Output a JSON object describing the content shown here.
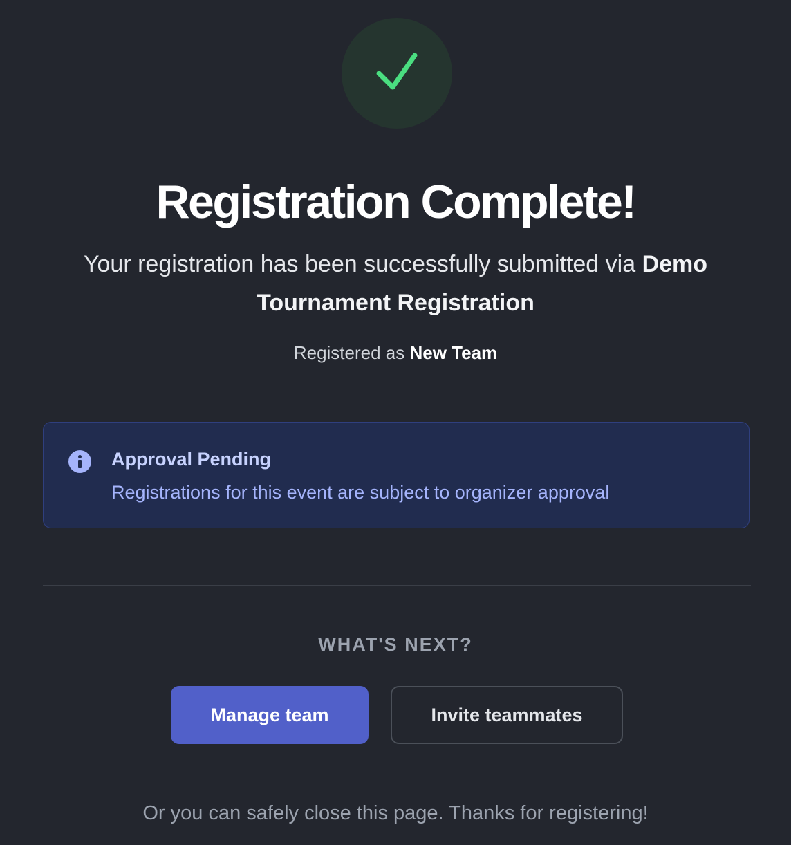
{
  "status_icon": {
    "name": "checkmark-icon",
    "color": "#4ade80",
    "background": "#25352f"
  },
  "title": "Registration Complete!",
  "subtitle": {
    "prefix": "Your registration has been successfully submitted via ",
    "form_name": "Demo Tournament Registration"
  },
  "registered": {
    "prefix": "Registered as ",
    "team_name": "New Team"
  },
  "alert": {
    "icon": "info-icon",
    "title": "Approval Pending",
    "message": "Registrations for this event are subject to organizer approval",
    "background": "#212c4f",
    "accent": "#a5b4fc"
  },
  "next": {
    "heading": "WHAT'S NEXT?",
    "primary_button": "Manage team",
    "secondary_button": "Invite teammates"
  },
  "footer_note": "Or you can safely close this page. Thanks for registering!",
  "colors": {
    "page_background": "#23262e",
    "primary_button": "#5160c9",
    "muted_text": "#9ca3af"
  }
}
